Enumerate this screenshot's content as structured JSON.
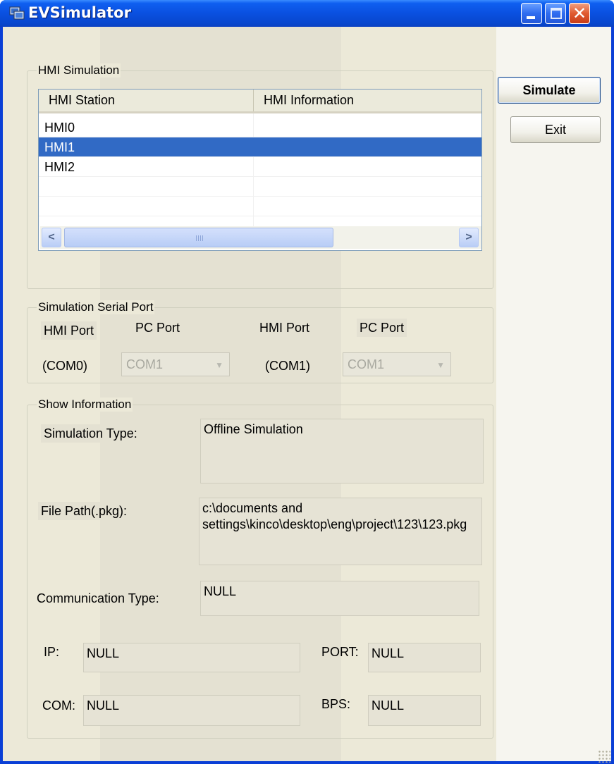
{
  "window": {
    "title": "EVSimulator"
  },
  "hmi_simulation": {
    "group_label": "HMI Simulation",
    "columns": [
      "HMI Station",
      "HMI Information"
    ],
    "rows": [
      {
        "station": "HMI0",
        "info": ""
      },
      {
        "station": "HMI1",
        "info": ""
      },
      {
        "station": "HMI2",
        "info": ""
      }
    ],
    "selected_row": "HMI1",
    "scrollbar_grip": "III"
  },
  "buttons": {
    "simulate": "Simulate",
    "exit": "Exit"
  },
  "serial_port": {
    "group_label": "Simulation Serial Port",
    "hmi_port_label_1": "HMI Port",
    "pc_port_label_1": "PC Port",
    "hmi_port_label_2": "HMI Port",
    "pc_port_label_2": "PC Port",
    "com0": "(COM0)",
    "com1": "(COM1)",
    "combo1_value": "COM1",
    "combo2_value": "COM1"
  },
  "show_information": {
    "group_label": "Show Information",
    "simulation_type_label": "Simulation Type:",
    "simulation_type_value": "Offline Simulation",
    "file_path_label": "File Path(.pkg):",
    "file_path_value": "c:\\documents and settings\\kinco\\desktop\\eng\\project\\123\\123.pkg",
    "communication_type_label": "Communication Type:",
    "communication_type_value": "NULL",
    "ip_label": "IP:",
    "ip_value": "NULL",
    "port_label": "PORT:",
    "port_value": "NULL",
    "com_label": "COM:",
    "com_value": "NULL",
    "bps_label": "BPS:",
    "bps_value": "NULL"
  },
  "colors": {
    "titlebar": "#0a50e0",
    "selection": "#316ac5",
    "face": "#ece9d8"
  }
}
